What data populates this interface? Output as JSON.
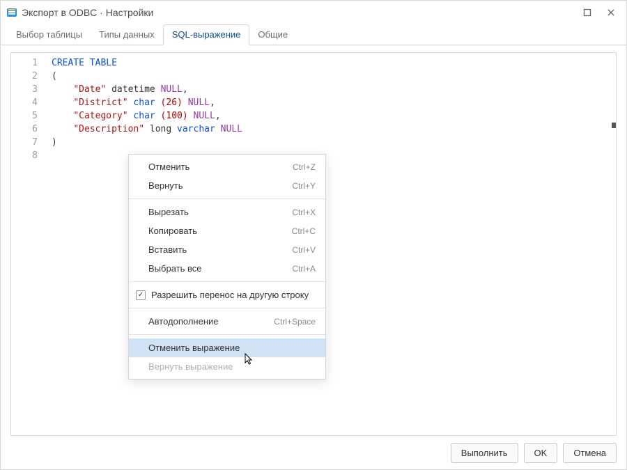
{
  "title": "Экспорт в ODBC · Настройки",
  "tabs": [
    {
      "label": "Выбор таблицы",
      "active": false
    },
    {
      "label": "Типы данных",
      "active": false
    },
    {
      "label": "SQL-выражение",
      "active": true
    },
    {
      "label": "Общие",
      "active": false
    }
  ],
  "code_lines": [
    1,
    2,
    3,
    4,
    5,
    6,
    7,
    8
  ],
  "sql": {
    "create": "CREATE",
    "table": "TABLE",
    "lparen": "(",
    "rparen": ")",
    "cols": [
      {
        "name": "\"Date\"",
        "type1": "datetime",
        "type2": "",
        "args": "",
        "null": "NULL",
        "comma": ","
      },
      {
        "name": "\"District\"",
        "type1": "char",
        "type2": "",
        "args": " (26)",
        "null": "NULL",
        "comma": ","
      },
      {
        "name": "\"Category\"",
        "type1": "char",
        "type2": "",
        "args": " (100)",
        "null": "NULL",
        "comma": ","
      },
      {
        "name": "\"Description\"",
        "type1": "long",
        "type2": "varchar",
        "args": "",
        "null": "NULL",
        "comma": ""
      }
    ]
  },
  "context_menu": {
    "items": [
      {
        "label": "Отменить",
        "accel": "Ctrl+Z"
      },
      {
        "label": "Вернуть",
        "accel": "Ctrl+Y"
      }
    ],
    "items2": [
      {
        "label": "Вырезать",
        "accel": "Ctrl+X"
      },
      {
        "label": "Копировать",
        "accel": "Ctrl+C"
      },
      {
        "label": "Вставить",
        "accel": "Ctrl+V"
      },
      {
        "label": "Выбрать все",
        "accel": "Ctrl+A"
      }
    ],
    "wrap_label": "Разрешить перенос на другую строку",
    "wrap_checked": true,
    "items3": [
      {
        "label": "Автодополнение",
        "accel": "Ctrl+Space"
      }
    ],
    "items4": [
      {
        "label": "Отменить выражение",
        "accel": "",
        "hover": true
      },
      {
        "label": "Вернуть выражение",
        "accel": "",
        "disabled": true
      }
    ]
  },
  "footer": {
    "run": "Выполнить",
    "ok": "OK",
    "cancel": "Отмена"
  }
}
